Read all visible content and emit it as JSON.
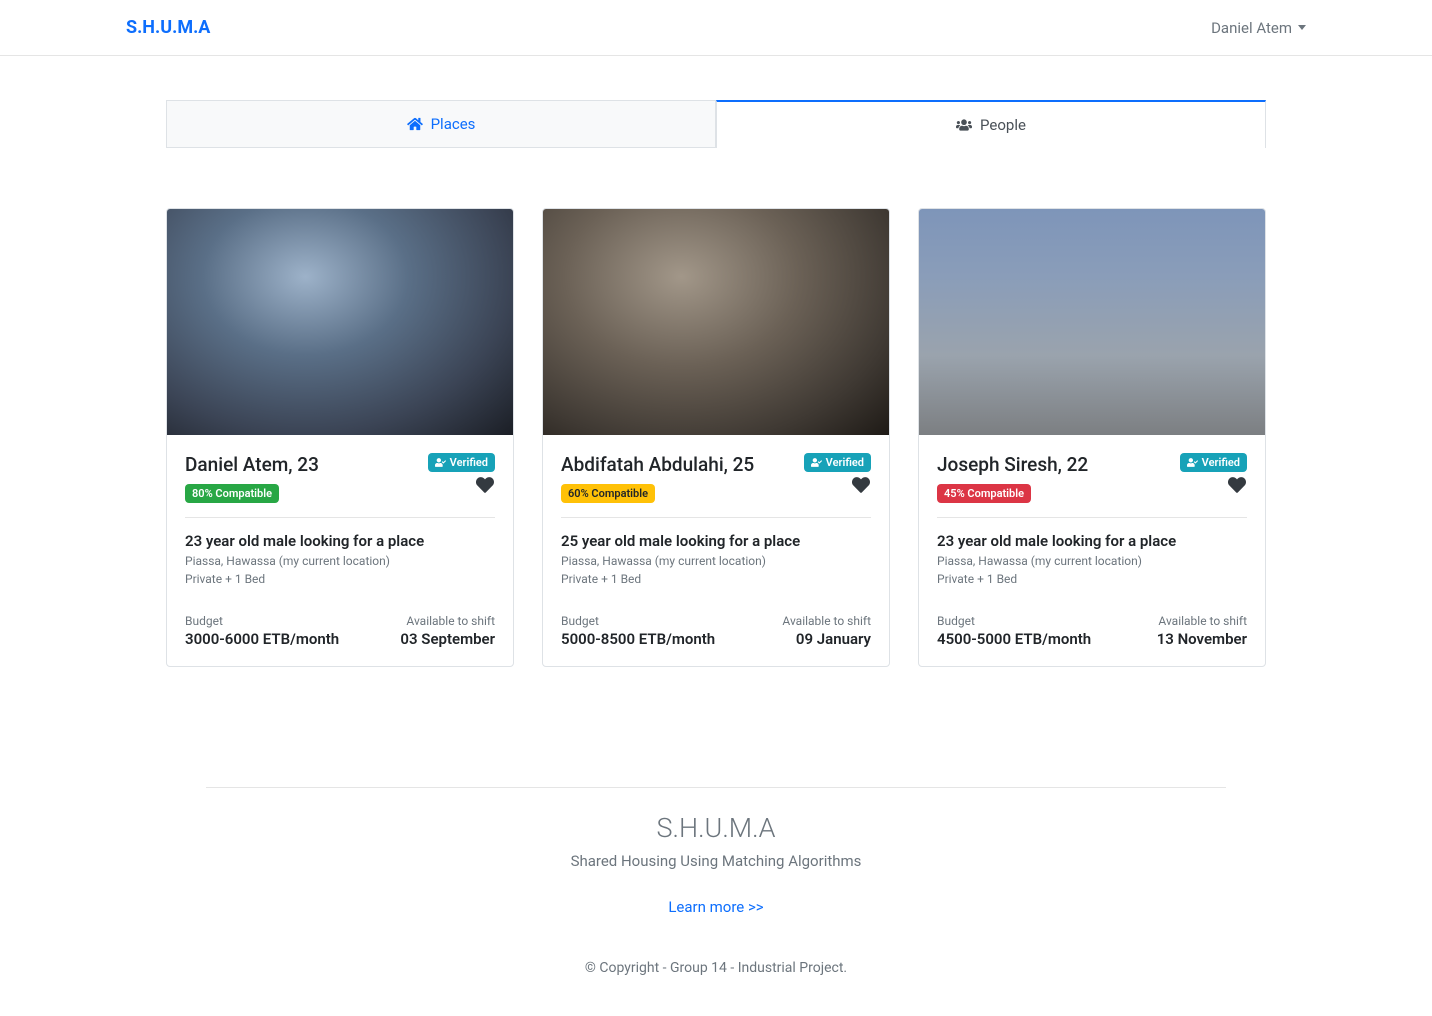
{
  "navbar": {
    "brand": "S.H.U.M.A",
    "user": "Daniel Atem"
  },
  "tabs": {
    "places": "Places",
    "people": "People"
  },
  "verified_label": "Verified",
  "labels": {
    "budget": "Budget",
    "available": "Available to shift"
  },
  "cards": [
    {
      "name": "Daniel Atem, 23",
      "compat": "80% Compatible",
      "compat_class": "badge-success",
      "desc": "23 year old male looking for a place",
      "loc": "Piassa, Hawassa (my current location)",
      "room": "Private + 1 Bed",
      "budget": "3000-6000 ETB/month",
      "available": "03 September",
      "bg": "radial-gradient(ellipse at 40% 30%, #9db2c9 0%, #5a6f87 35%, #3b4455 70%, #1b1e25 100%)"
    },
    {
      "name": "Abdifatah Abdulahi, 25",
      "compat": "60% Compatible",
      "compat_class": "badge-warning",
      "desc": "25 year old male looking for a place",
      "loc": "Piassa, Hawassa (my current location)",
      "room": "Private + 1 Bed",
      "budget": "5000-8500 ETB/month",
      "available": "09 January",
      "bg": "radial-gradient(ellipse at 40% 30%, #a29789 0%, #6b6156 40%, #3f3933 75%, #1e1a16 100%)"
    },
    {
      "name": "Joseph Siresh, 22",
      "compat": "45% Compatible",
      "compat_class": "badge-danger",
      "desc": "23 year old male looking for a place",
      "loc": "Piassa, Hawassa (my current location)",
      "room": "Private + 1 Bed",
      "budget": "4500-5000 ETB/month",
      "available": "13 November",
      "bg": "linear-gradient(180deg, #7e95b9 0%, #8a9db9 30%, #9aa3ad 65%, #7c7f82 100%)"
    }
  ],
  "footer": {
    "title": "S.H.U.M.A",
    "sub": "Shared Housing Using Matching Algorithms",
    "link": "Learn more >>",
    "copy": "© Copyright - Group 14 - Industrial Project."
  }
}
